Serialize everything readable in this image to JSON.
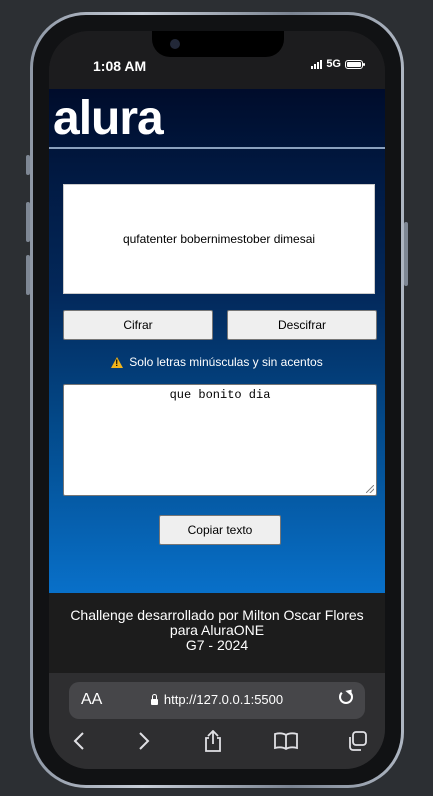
{
  "status_bar": {
    "time": "1:08 AM",
    "network": "5G"
  },
  "page": {
    "logo": "alura",
    "encrypted_text": "qufatenter bobernimestober dimesai",
    "encrypt_button": "Cifrar",
    "decrypt_button": "Descifrar",
    "warning": "Solo letras minúsculas y sin acentos",
    "output_text": "que bonito dia",
    "copy_button": "Copiar texto"
  },
  "footer": {
    "line1": "Challenge desarrollado por Milton Oscar Flores",
    "line2": "para AluraONE",
    "line3": "G7 - 2024"
  },
  "browser": {
    "text_size_label": "AA",
    "url": "http://127.0.0.1:5500",
    "toolbar": [
      "back-icon",
      "forward-icon",
      "share-icon",
      "bookmarks-icon",
      "tabs-icon"
    ]
  }
}
